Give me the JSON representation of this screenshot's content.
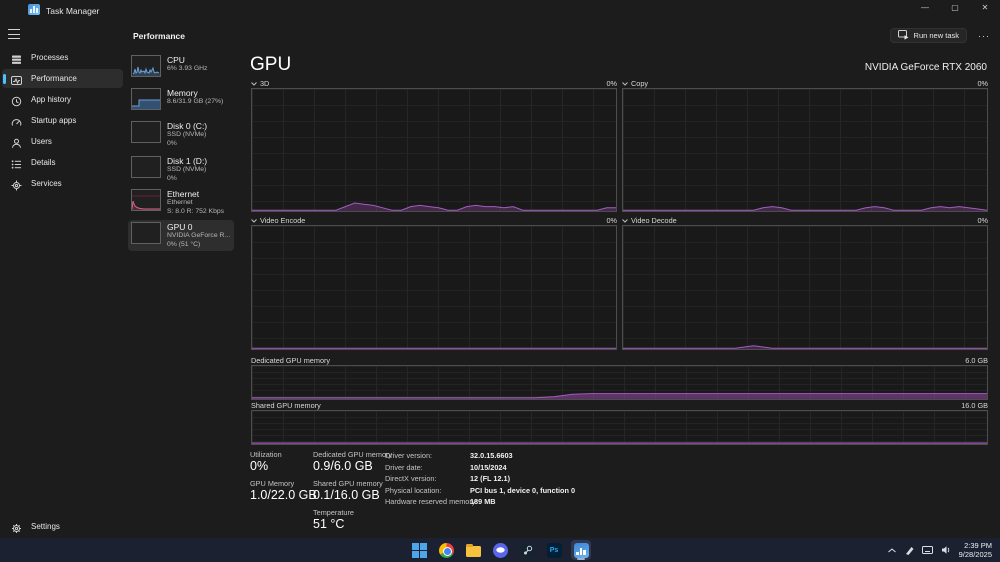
{
  "titlebar": {
    "title": "Task Manager",
    "minimize_glyph": "—",
    "maximize_glyph": "▢",
    "close_glyph": "✕"
  },
  "sidebar": {
    "items": [
      {
        "label": "Processes"
      },
      {
        "label": "Performance",
        "selected": true
      },
      {
        "label": "App history"
      },
      {
        "label": "Startup apps"
      },
      {
        "label": "Users"
      },
      {
        "label": "Details"
      },
      {
        "label": "Services"
      }
    ],
    "settings_label": "Settings"
  },
  "header": {
    "page_title": "Performance",
    "run_new_task_label": "Run new task",
    "more_label": "···"
  },
  "perf_list": [
    {
      "name": "CPU",
      "line1": "6% 3.93 GHz"
    },
    {
      "name": "Memory",
      "line1": "8.6/31.9 GB (27%)"
    },
    {
      "name": "Disk 0 (C:)",
      "line1": "SSD (NVMe)",
      "line2": "0%"
    },
    {
      "name": "Disk 1 (D:)",
      "line1": "SSD (NVMe)",
      "line2": "0%"
    },
    {
      "name": "Ethernet",
      "line1": "Ethernet",
      "line2": "S: 8.0 R: 752 Kbps"
    },
    {
      "name": "GPU 0",
      "line1": "NVIDIA GeForce R...",
      "line2": "0% (51 °C)",
      "selected": true
    }
  ],
  "gpu": {
    "title": "GPU",
    "device": "NVIDIA GeForce RTX 2060",
    "charts": {
      "three_d": {
        "label": "3D",
        "value": "0%"
      },
      "copy": {
        "label": "Copy",
        "value": "0%"
      },
      "video_encode": {
        "label": "Video Encode",
        "value": "0%"
      },
      "video_decode": {
        "label": "Video Decode",
        "value": "0%"
      },
      "dedicated_memory": {
        "label": "Dedicated GPU memory",
        "max": "6.0 GB"
      },
      "shared_memory": {
        "label": "Shared GPU memory",
        "max": "16.0 GB"
      }
    },
    "stats": {
      "utilization": {
        "label": "Utilization",
        "value": "0%"
      },
      "gpu_memory": {
        "label": "GPU Memory",
        "value": "1.0/22.0 GB"
      },
      "dedicated": {
        "label": "Dedicated GPU memory",
        "value": "0.9/6.0 GB"
      },
      "shared": {
        "label": "Shared GPU memory",
        "value": "0.1/16.0 GB"
      },
      "temperature": {
        "label": "Temperature",
        "value": "51 °C"
      }
    },
    "details": [
      {
        "label": "Driver version:",
        "value": "32.0.15.6603"
      },
      {
        "label": "Driver date:",
        "value": "10/15/2024"
      },
      {
        "label": "DirectX version:",
        "value": "12 (FL 12.1)"
      },
      {
        "label": "Physical location:",
        "value": "PCI bus 1, device 0, function 0"
      },
      {
        "label": "Hardware reserved memory:",
        "value": "189 MB"
      }
    ]
  },
  "chart_data": [
    {
      "id": "gpu3d",
      "type": "area",
      "title": "3D",
      "ylabel": "%",
      "ylim": [
        0,
        100
      ],
      "color": "#a25dbd",
      "fill": "rgba(146,70,166,0.35)",
      "values": [
        0,
        0,
        0,
        0,
        0,
        0,
        0,
        0,
        0,
        0,
        3,
        6,
        5,
        4,
        2,
        0,
        0,
        3,
        4,
        3,
        2,
        0,
        0,
        3,
        4,
        3,
        3,
        2,
        3,
        0,
        0,
        0,
        0,
        0,
        0,
        0,
        0,
        0,
        2,
        2
      ]
    },
    {
      "id": "copy",
      "type": "area",
      "title": "Copy",
      "ylabel": "%",
      "ylim": [
        0,
        100
      ],
      "color": "#a25dbd",
      "fill": "rgba(146,70,166,0.35)",
      "values": [
        0,
        0,
        0,
        0,
        0,
        0,
        0,
        0,
        0,
        0,
        0,
        0,
        0,
        0,
        0,
        2,
        3,
        2,
        0,
        0,
        0,
        0,
        0,
        0,
        0,
        0,
        2,
        3,
        2,
        0,
        0,
        0,
        0,
        2,
        3,
        2,
        3,
        2,
        1,
        0
      ]
    },
    {
      "id": "vencode",
      "type": "area",
      "title": "Video Encode",
      "ylabel": "%",
      "ylim": [
        0,
        100
      ],
      "color": "#a25dbd",
      "fill": "rgba(146,70,166,0.35)",
      "values": [
        0,
        0,
        0,
        0,
        0,
        0,
        0,
        0,
        0,
        0,
        0,
        0,
        0,
        0,
        0,
        0,
        0,
        0,
        0,
        0,
        0,
        0,
        0,
        0,
        0,
        0,
        0,
        0,
        0,
        0,
        0,
        0,
        0,
        0,
        0,
        0,
        0,
        0,
        0,
        0
      ]
    },
    {
      "id": "vdecode",
      "type": "area",
      "title": "Video Decode",
      "ylabel": "%",
      "ylim": [
        0,
        100
      ],
      "color": "#a25dbd",
      "fill": "rgba(146,70,166,0.35)",
      "values": [
        0,
        0,
        0,
        0,
        0,
        0,
        0,
        0,
        0,
        0,
        0,
        0,
        0,
        1,
        2,
        1,
        0,
        0,
        0,
        0,
        0,
        0,
        0,
        0,
        0,
        0,
        0,
        0,
        0,
        0,
        0,
        0,
        0,
        0,
        0,
        0,
        0,
        0,
        0,
        0
      ]
    },
    {
      "id": "dedmem",
      "type": "area",
      "title": "Dedicated GPU memory",
      "ylabel": "GB",
      "ylim": [
        0,
        6
      ],
      "color": "#a25dbd",
      "fill": "rgba(146,70,166,0.55)",
      "values": [
        0.08,
        0.08,
        0.08,
        0.08,
        0.08,
        0.08,
        0.08,
        0.08,
        0.08,
        0.08,
        0.08,
        0.08,
        0.08,
        0.08,
        0.08,
        0.08,
        0.3,
        0.75,
        0.9,
        0.9,
        0.9,
        0.9,
        0.9,
        0.9,
        0.9,
        0.9,
        0.9,
        0.9,
        0.9,
        0.9,
        0.9,
        0.9,
        0.9,
        0.9,
        0.9,
        0.9,
        0.9,
        0.9,
        0.9,
        0.9
      ]
    },
    {
      "id": "sharedmem",
      "type": "area",
      "title": "Shared GPU memory",
      "ylabel": "GB",
      "ylim": [
        0,
        16
      ],
      "color": "#a25dbd",
      "fill": "rgba(146,70,166,0.55)",
      "values": [
        0.1,
        0.1,
        0.1,
        0.1,
        0.1,
        0.1,
        0.1,
        0.1,
        0.1,
        0.1,
        0.1,
        0.1,
        0.1,
        0.1,
        0.1,
        0.1,
        0.1,
        0.1,
        0.1,
        0.1,
        0.1,
        0.1,
        0.1,
        0.1,
        0.1,
        0.1,
        0.1,
        0.1,
        0.1,
        0.1,
        0.1,
        0.1,
        0.1,
        0.1,
        0.1,
        0.1,
        0.1,
        0.1,
        0.1,
        0.1
      ]
    }
  ],
  "taskbar": {
    "ps_label": "Ps",
    "clock": {
      "time": "2:39 PM",
      "date": "9/28/2025"
    }
  },
  "colors": {
    "accent": "#4cc2ff",
    "gpu_purple": "#a25dbd",
    "cpu_blue": "#6aa1d8",
    "ethernet_pink": "#d4668c"
  }
}
